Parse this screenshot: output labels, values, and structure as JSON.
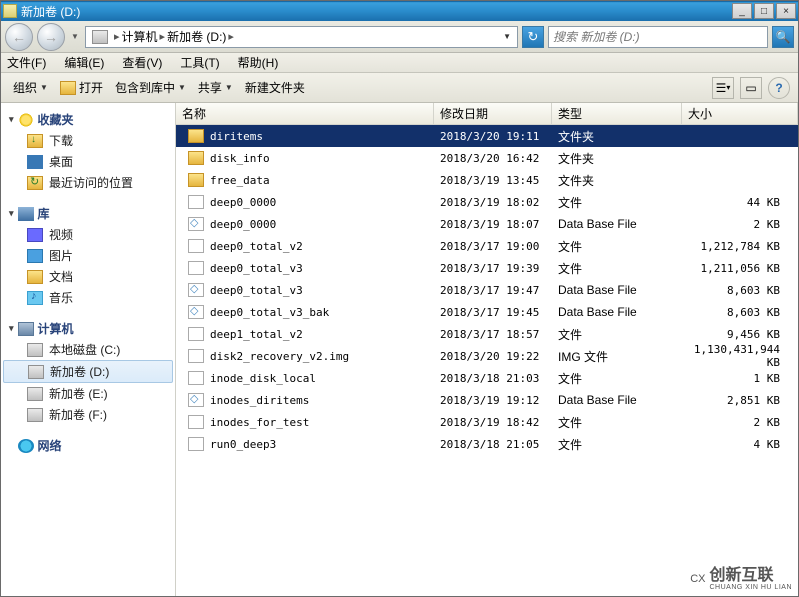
{
  "window": {
    "title": "新加卷 (D:)",
    "min": "_",
    "max": "□",
    "close": "×"
  },
  "nav": {
    "back_arrow": "←",
    "fwd_arrow": "→",
    "addr_seg1": "计算机",
    "addr_seg2": "新加卷 (D:)",
    "refresh": "↻",
    "search_hint": "搜索 新加卷 (D:)",
    "search_go": "🔍"
  },
  "menu": {
    "file": "文件(F)",
    "edit": "编辑(E)",
    "view": "查看(V)",
    "tools": "工具(T)",
    "help": "帮助(H)"
  },
  "toolbar": {
    "organize": "组织",
    "open": "打开",
    "include": "包含到库中",
    "share": "共享",
    "newfolder": "新建文件夹"
  },
  "sidebar": {
    "fav": "收藏夹",
    "downloads": "下载",
    "desktop": "桌面",
    "recent": "最近访问的位置",
    "lib": "库",
    "video": "视频",
    "pics": "图片",
    "docs": "文档",
    "music": "音乐",
    "computer": "计算机",
    "driveC": "本地磁盘 (C:)",
    "driveD": "新加卷 (D:)",
    "driveE": "新加卷 (E:)",
    "driveF": "新加卷 (F:)",
    "network": "网络"
  },
  "columns": {
    "name": "名称",
    "date": "修改日期",
    "type": "类型",
    "size": "大小"
  },
  "types": {
    "folder": "文件夹",
    "file": "文件",
    "db": "Data Base File",
    "img": "IMG 文件"
  },
  "files": [
    {
      "icon": "folder",
      "name": "diritems",
      "date": "2018/3/20 19:11",
      "typekey": "folder",
      "size": "",
      "selected": true
    },
    {
      "icon": "folder",
      "name": "disk_info",
      "date": "2018/3/20 16:42",
      "typekey": "folder",
      "size": ""
    },
    {
      "icon": "folder",
      "name": "free_data",
      "date": "2018/3/19 13:45",
      "typekey": "folder",
      "size": ""
    },
    {
      "icon": "file",
      "name": "deep0_0000",
      "date": "2018/3/19 18:02",
      "typekey": "file",
      "size": "44 KB"
    },
    {
      "icon": "db",
      "name": "deep0_0000",
      "date": "2018/3/19 18:07",
      "typekey": "db",
      "size": "2 KB"
    },
    {
      "icon": "file",
      "name": "deep0_total_v2",
      "date": "2018/3/17 19:00",
      "typekey": "file",
      "size": "1,212,784 KB"
    },
    {
      "icon": "file",
      "name": "deep0_total_v3",
      "date": "2018/3/17 19:39",
      "typekey": "file",
      "size": "1,211,056 KB"
    },
    {
      "icon": "db",
      "name": "deep0_total_v3",
      "date": "2018/3/17 19:47",
      "typekey": "db",
      "size": "8,603 KB"
    },
    {
      "icon": "db",
      "name": "deep0_total_v3_bak",
      "date": "2018/3/17 19:45",
      "typekey": "db",
      "size": "8,603 KB"
    },
    {
      "icon": "file",
      "name": "deep1_total_v2",
      "date": "2018/3/17 18:57",
      "typekey": "file",
      "size": "9,456 KB"
    },
    {
      "icon": "file",
      "name": "disk2_recovery_v2.img",
      "date": "2018/3/20 19:22",
      "typekey": "img",
      "size": "1,130,431,944 KB"
    },
    {
      "icon": "file",
      "name": "inode_disk_local",
      "date": "2018/3/18 21:03",
      "typekey": "file",
      "size": "1 KB"
    },
    {
      "icon": "db",
      "name": "inodes_diritems",
      "date": "2018/3/19 19:12",
      "typekey": "db",
      "size": "2,851 KB"
    },
    {
      "icon": "file",
      "name": "inodes_for_test",
      "date": "2018/3/19 18:42",
      "typekey": "file",
      "size": "2 KB"
    },
    {
      "icon": "file",
      "name": "run0_deep3",
      "date": "2018/3/18 21:05",
      "typekey": "file",
      "size": "4 KB"
    }
  ],
  "watermark": {
    "logo": "CX",
    "line1": "创新互联",
    "line2": "CHUANG XIN HU LIAN"
  }
}
